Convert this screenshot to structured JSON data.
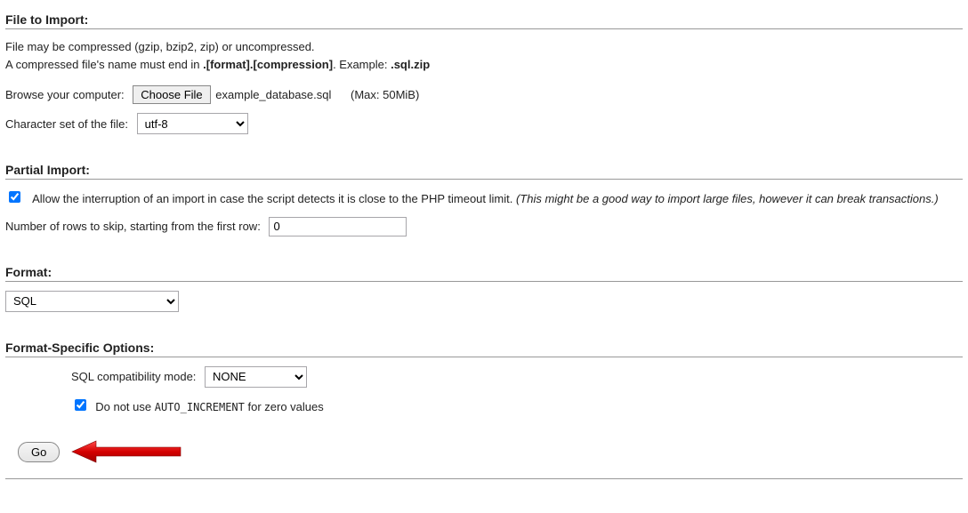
{
  "file_to_import": {
    "header": "File to Import:",
    "desc1": "File may be compressed (gzip, bzip2, zip) or uncompressed.",
    "desc2_pre": "A compressed file's name must end in ",
    "desc2_bold1": ".[format].[compression]",
    "desc2_mid": ". Example: ",
    "desc2_bold2": ".sql.zip",
    "browse_label": "Browse your computer:",
    "choose_button": "Choose File",
    "filename": "example_database.sql",
    "max_size": "(Max: 50MiB)",
    "charset_label": "Character set of the file:",
    "charset_value": "utf-8"
  },
  "partial_import": {
    "header": "Partial Import:",
    "allow_interrupt_label": "Allow the interruption of an import in case the script detects it is close to the PHP timeout limit. ",
    "allow_interrupt_note": "(This might be a good way to import large files, however it can break transactions.)",
    "skip_label": "Number of rows to skip, starting from the first row:",
    "skip_value": "0"
  },
  "format": {
    "header": "Format:",
    "value": "SQL"
  },
  "format_specific": {
    "header": "Format-Specific Options:",
    "compat_label": "SQL compatibility mode:",
    "compat_value": "NONE",
    "auto_inc_pre": "Do not use ",
    "auto_inc_code": "AUTO_INCREMENT",
    "auto_inc_post": " for zero values"
  },
  "go_button": "Go"
}
